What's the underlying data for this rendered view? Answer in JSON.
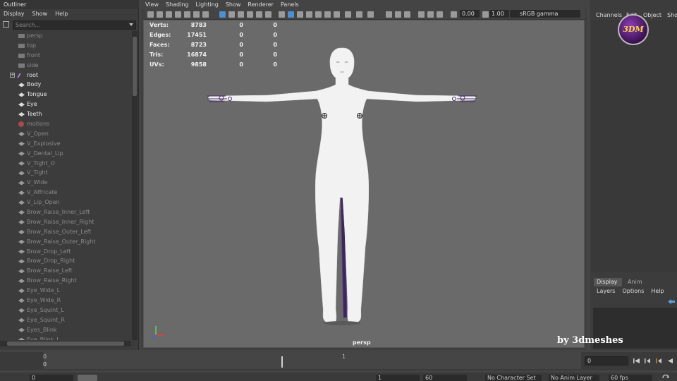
{
  "outliner": {
    "title": "Outliner",
    "menu": [
      "Display",
      "Show",
      "Help"
    ],
    "search_placeholder": "Search...",
    "items": [
      {
        "label": "persp",
        "icon": "camera-icon",
        "dim": true
      },
      {
        "label": "top",
        "icon": "camera-icon",
        "dim": true
      },
      {
        "label": "front",
        "icon": "camera-icon",
        "dim": true
      },
      {
        "label": "side",
        "icon": "camera-icon",
        "dim": true
      },
      {
        "label": "root",
        "icon": "joint-icon",
        "dim": false
      },
      {
        "label": "Body",
        "icon": "mesh-icon",
        "dim": false
      },
      {
        "label": "Tongue",
        "icon": "mesh-icon",
        "dim": false
      },
      {
        "label": "Eye",
        "icon": "mesh-icon",
        "dim": false
      },
      {
        "label": "Teeth",
        "icon": "mesh-icon",
        "dim": false
      },
      {
        "label": "motions",
        "icon": "blendshape-icon",
        "dim": true
      },
      {
        "label": "V_Open",
        "icon": "mesh-icon",
        "dim": true
      },
      {
        "label": "V_Explosive",
        "icon": "mesh-icon",
        "dim": true
      },
      {
        "label": "V_Dental_Lip",
        "icon": "mesh-icon",
        "dim": true
      },
      {
        "label": "V_Tight_O",
        "icon": "mesh-icon",
        "dim": true
      },
      {
        "label": "V_Tight",
        "icon": "mesh-icon",
        "dim": true
      },
      {
        "label": "V_Wide",
        "icon": "mesh-icon",
        "dim": true
      },
      {
        "label": "V_Affricate",
        "icon": "mesh-icon",
        "dim": true
      },
      {
        "label": "V_Lip_Open",
        "icon": "mesh-icon",
        "dim": true
      },
      {
        "label": "Brow_Raise_Inner_Left",
        "icon": "mesh-icon",
        "dim": true
      },
      {
        "label": "Brow_Raise_Inner_Right",
        "icon": "mesh-icon",
        "dim": true
      },
      {
        "label": "Brow_Raise_Outer_Left",
        "icon": "mesh-icon",
        "dim": true
      },
      {
        "label": "Brow_Raise_Outer_Right",
        "icon": "mesh-icon",
        "dim": true
      },
      {
        "label": "Brow_Drop_Left",
        "icon": "mesh-icon",
        "dim": true
      },
      {
        "label": "Brow_Drop_Right",
        "icon": "mesh-icon",
        "dim": true
      },
      {
        "label": "Brow_Raise_Left",
        "icon": "mesh-icon",
        "dim": true
      },
      {
        "label": "Brow_Raise_Right",
        "icon": "mesh-icon",
        "dim": true
      },
      {
        "label": "Eye_Wide_L",
        "icon": "mesh-icon",
        "dim": true
      },
      {
        "label": "Eye_Wide_R",
        "icon": "mesh-icon",
        "dim": true
      },
      {
        "label": "Eye_Squint_L",
        "icon": "mesh-icon",
        "dim": true
      },
      {
        "label": "Eye_Squint_R",
        "icon": "mesh-icon",
        "dim": true
      },
      {
        "label": "Eyes_Blink",
        "icon": "mesh-icon",
        "dim": true
      },
      {
        "label": "Eye_Blink_L",
        "icon": "mesh-icon",
        "dim": true
      }
    ]
  },
  "viewport": {
    "menu": [
      "View",
      "Shading",
      "Lighting",
      "Show",
      "Renderer",
      "Panels"
    ],
    "exposure": "0.00",
    "gamma": "1.00",
    "colorspace": "sRGB gamma",
    "camera": "persp",
    "hud": [
      {
        "label": "Verts:",
        "v1": "8783",
        "v2": "0",
        "v3": "0"
      },
      {
        "label": "Edges:",
        "v1": "17451",
        "v2": "0",
        "v3": "0"
      },
      {
        "label": "Faces:",
        "v1": "8723",
        "v2": "0",
        "v3": "0"
      },
      {
        "label": "Tris:",
        "v1": "16874",
        "v2": "0",
        "v3": "0"
      },
      {
        "label": "UVs:",
        "v1": "9858",
        "v2": "0",
        "v3": "0"
      }
    ]
  },
  "channel_box": {
    "menu": [
      "Channels",
      "Edit",
      "Object",
      "Show"
    ]
  },
  "layers": {
    "tabs": [
      "Display",
      "Anim"
    ],
    "menu": [
      "Layers",
      "Options",
      "Help"
    ]
  },
  "watermark": {
    "logo": "3DM",
    "credit": "by 3dmeshes"
  },
  "timeline": {
    "tick_start": "0",
    "tick_mid": "1",
    "current_frame": "0",
    "current_frame_field": "0"
  },
  "range": {
    "start": "0",
    "end_field": "1",
    "end": "60",
    "character_set": "No Character Set",
    "anim_layer": "No Anim Layer",
    "fps": "60 fps"
  },
  "colors": {
    "background": "#444444",
    "viewport_bg": "#6a6a6a",
    "selected_tool": "#4d8fcf",
    "logo_purple": "#5e2a80",
    "logo_gold": "#ffd54a"
  }
}
